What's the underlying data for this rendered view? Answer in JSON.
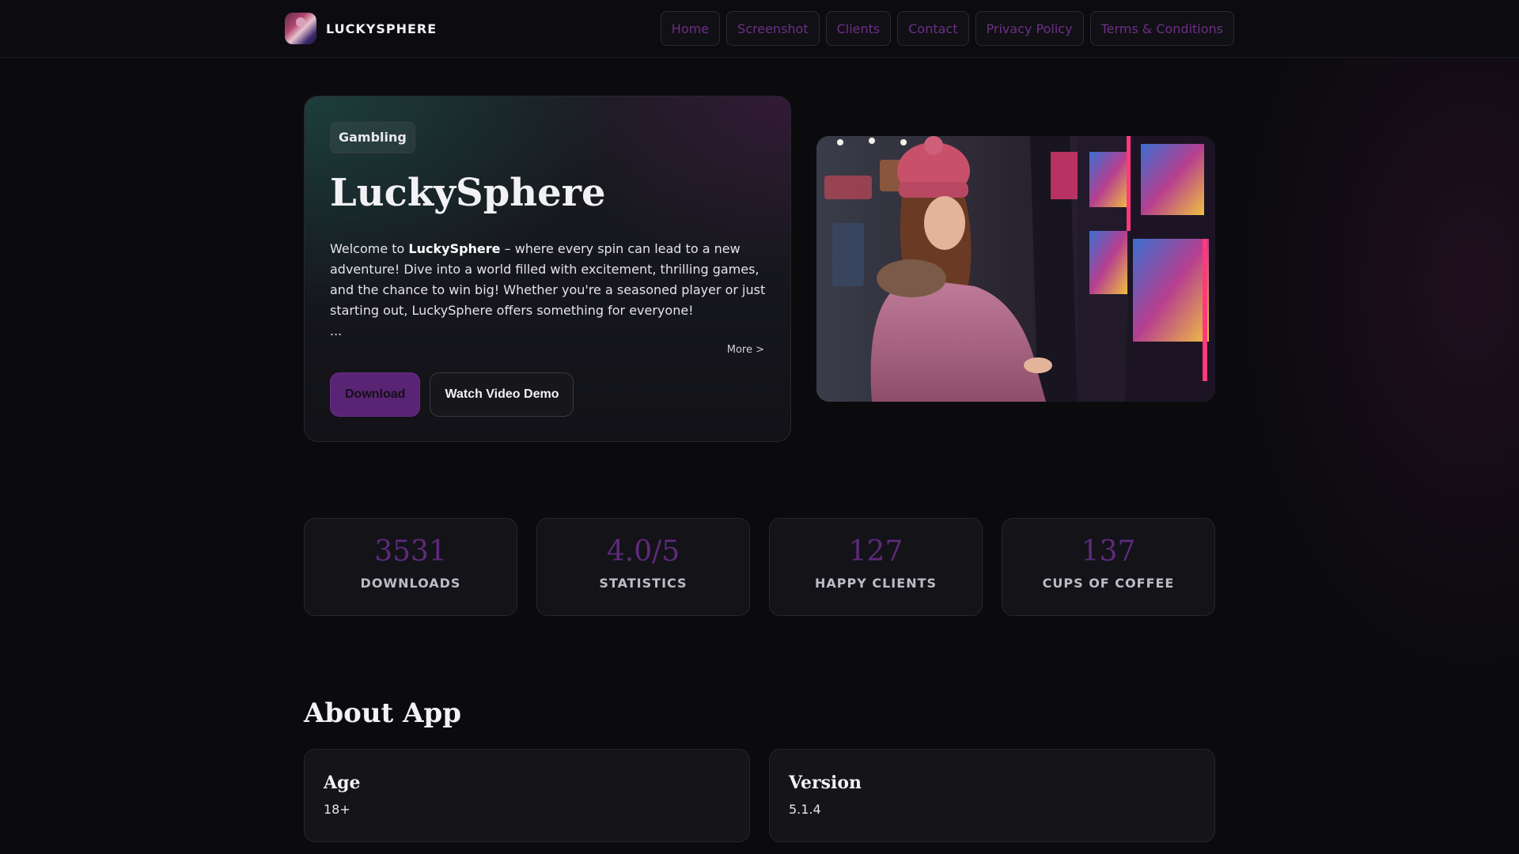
{
  "brand": {
    "name": "LUCKYSPHERE"
  },
  "nav": {
    "items": [
      "Home",
      "Screenshot",
      "Clients",
      "Contact",
      "Privacy Policy",
      "Terms & Conditions"
    ]
  },
  "hero": {
    "badge": "Gambling",
    "title": "LuckySphere",
    "desc_prefix": "Welcome to ",
    "desc_brand": "LuckySphere",
    "desc_rest": " – where every spin can lead to a new adventure! Dive into a world filled with excitement, thrilling games, and the chance to win big! Whether you're a seasoned player or just starting out, LuckySphere offers something for everyone!",
    "ellipsis": "...",
    "more_link": "More >",
    "download_label": "Download",
    "demo_label": "Watch Video Demo"
  },
  "stats": [
    {
      "value": "3531",
      "label": "DOWNLOADS"
    },
    {
      "value": "4.0/5",
      "label": "STATISTICS"
    },
    {
      "value": "127",
      "label": "HAPPY CLIENTS"
    },
    {
      "value": "137",
      "label": "CUPS OF COFFEE"
    }
  ],
  "about": {
    "title": "About App",
    "cards": [
      {
        "title": "Age",
        "value": "18+"
      },
      {
        "title": "Version",
        "value": "5.1.4"
      }
    ]
  },
  "colors": {
    "accent": "#5a2474",
    "nav_text": "#6e2f86",
    "background": "#0b0b0e"
  }
}
